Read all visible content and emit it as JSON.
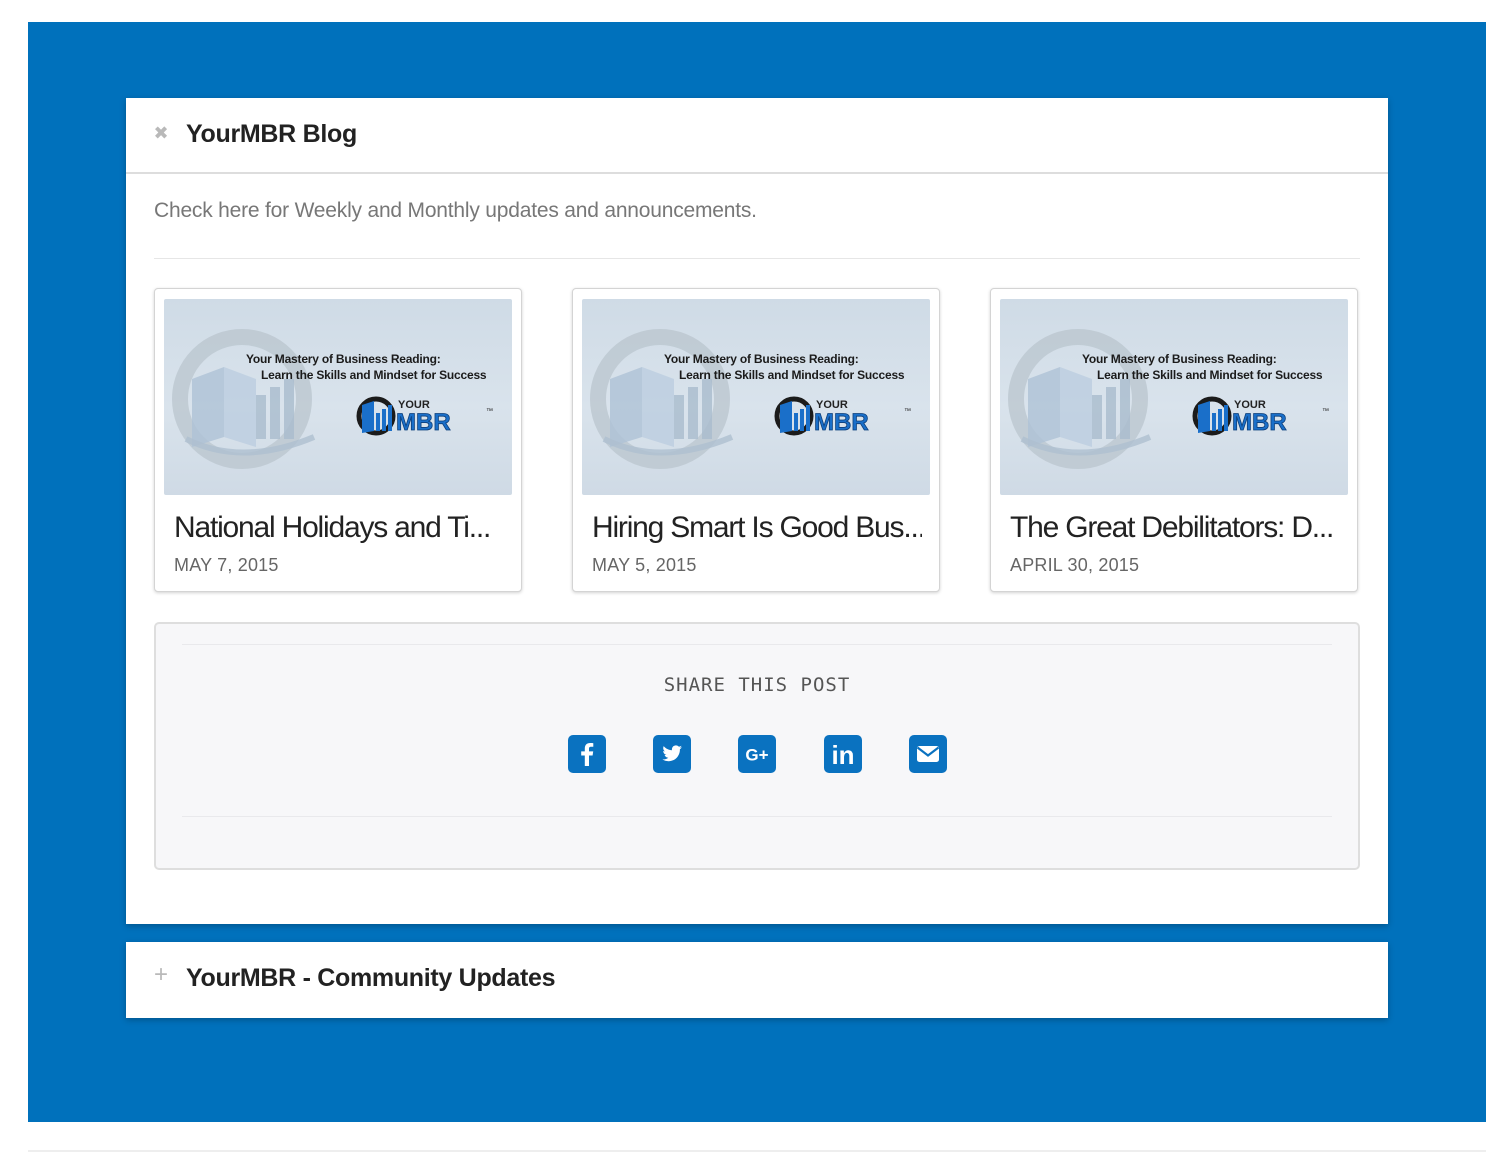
{
  "blog_panel": {
    "title": "YourMBR Blog",
    "toggle_icon": "close-icon",
    "intro": "Check here for Weekly and Monthly updates and announcements."
  },
  "posts": [
    {
      "title": "National Holidays and Ti...",
      "date": "MAY 7, 2015",
      "thumb_line1": "Your Mastery of Business Reading:",
      "thumb_line2": "Learn the Skills and Mindset for Success",
      "thumb_logo_top": "YOUR",
      "thumb_logo_main": "MBR",
      "thumb_logo_tm": "™"
    },
    {
      "title": "Hiring Smart Is Good Bus...",
      "date": "MAY 5, 2015",
      "thumb_line1": "Your Mastery of Business Reading:",
      "thumb_line2": "Learn the Skills and Mindset for Success",
      "thumb_logo_top": "YOUR",
      "thumb_logo_main": "MBR",
      "thumb_logo_tm": "™"
    },
    {
      "title": "The Great Debilitators: D...",
      "date": "APRIL 30, 2015",
      "thumb_line1": "Your Mastery of Business Reading:",
      "thumb_line2": "Learn the Skills and Mindset for Success",
      "thumb_logo_top": "YOUR",
      "thumb_logo_main": "MBR",
      "thumb_logo_tm": "™"
    }
  ],
  "share": {
    "label": "SHARE THIS POST",
    "icons": [
      "facebook-icon",
      "twitter-icon",
      "google-plus-icon",
      "linkedin-icon",
      "email-icon"
    ],
    "google_plus_text": "G+",
    "linkedin_text": "in"
  },
  "community_panel": {
    "title": "YourMBR - Community Updates",
    "toggle_icon": "plus-icon"
  },
  "colors": {
    "background_blue": "#0071bc",
    "icon_blue": "#0a72c0",
    "logo_blue": "#1a6fc9",
    "text_dark": "#222222",
    "text_muted": "#777777"
  }
}
